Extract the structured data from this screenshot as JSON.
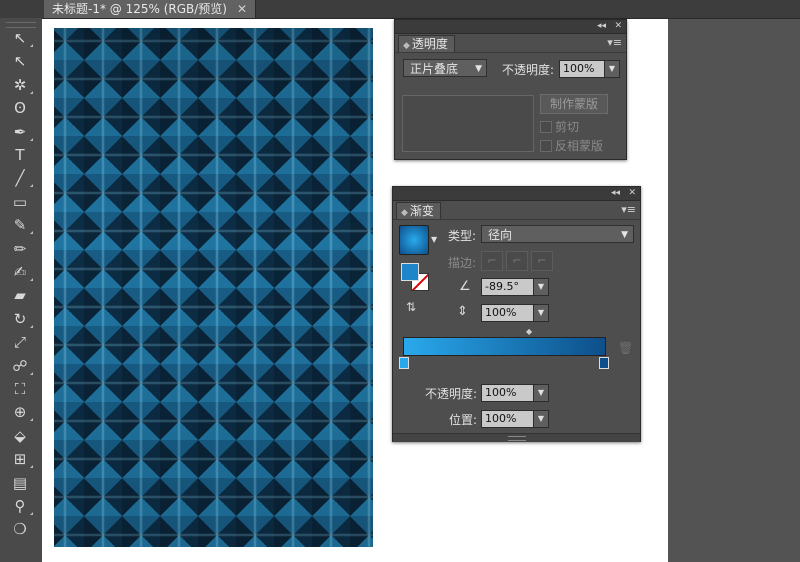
{
  "document": {
    "tab_title": "未标题-1* @ 125% (RGB/预览)",
    "close_glyph": "✕"
  },
  "toolbar": {
    "tools": [
      {
        "name": "selection-tool-icon",
        "glyph": "↖"
      },
      {
        "name": "direct-selection-tool-icon",
        "glyph": "↖"
      },
      {
        "name": "magic-wand-tool-icon",
        "glyph": "✲"
      },
      {
        "name": "lasso-tool-icon",
        "glyph": "ʘ"
      },
      {
        "name": "pen-tool-icon",
        "glyph": "✒"
      },
      {
        "name": "type-tool-icon",
        "glyph": "T"
      },
      {
        "name": "line-tool-icon",
        "glyph": "╱"
      },
      {
        "name": "rectangle-tool-icon",
        "glyph": "▭"
      },
      {
        "name": "paintbrush-tool-icon",
        "glyph": "✎"
      },
      {
        "name": "pencil-tool-icon",
        "glyph": "✏"
      },
      {
        "name": "blob-brush-tool-icon",
        "glyph": "✍"
      },
      {
        "name": "eraser-tool-icon",
        "glyph": "▰"
      },
      {
        "name": "rotate-tool-icon",
        "glyph": "↻"
      },
      {
        "name": "scale-tool-icon",
        "glyph": "⤢"
      },
      {
        "name": "warp-tool-icon",
        "glyph": "☍"
      },
      {
        "name": "free-transform-tool-icon",
        "glyph": "⛶"
      },
      {
        "name": "shape-builder-tool-icon",
        "glyph": "⊕"
      },
      {
        "name": "perspective-grid-tool-icon",
        "glyph": "⬙"
      },
      {
        "name": "mesh-tool-icon",
        "glyph": "⊞"
      },
      {
        "name": "gradient-tool-icon",
        "glyph": "▤"
      },
      {
        "name": "eyedropper-tool-icon",
        "glyph": "⚲"
      },
      {
        "name": "blend-tool-icon",
        "glyph": "❍"
      }
    ]
  },
  "transparency_panel": {
    "title": "透明度",
    "blend_mode": "正片叠底",
    "opacity_label": "不透明度:",
    "opacity_value": "100%",
    "make_mask_button": "制作蒙版",
    "clip_label": "剪切",
    "invert_mask_label": "反相蒙版"
  },
  "gradient_panel": {
    "title": "渐变",
    "type_label": "类型:",
    "type_value": "径向",
    "stroke_label": "描边:",
    "angle_value": "-89.5°",
    "aspect_value": "100%",
    "opacity_label": "不透明度:",
    "opacity_value": "100%",
    "location_label": "位置:",
    "location_value": "100%",
    "gradient_start_color": "#29a9ec",
    "gradient_end_color": "#0d4f8a"
  },
  "colors": {
    "artboard": "#ffffff",
    "pattern_base": "#0f3d5c"
  }
}
